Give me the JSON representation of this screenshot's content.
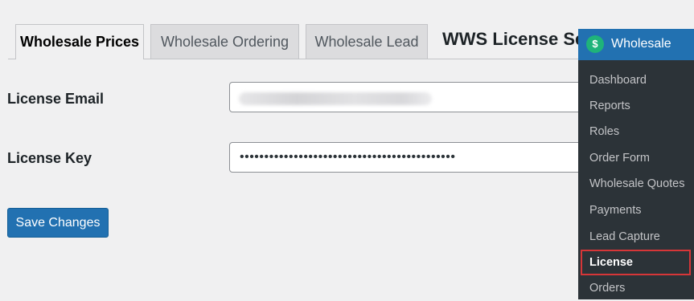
{
  "tabs": [
    {
      "label": "Wholesale Prices",
      "active": true
    },
    {
      "label": "Wholesale Ordering",
      "active": false
    },
    {
      "label": "Wholesale Lead",
      "active": false
    }
  ],
  "page_heading": "WWS License Sett",
  "form": {
    "email_label": "License Email",
    "email_value": "",
    "key_label": "License Key",
    "key_value": "••••••••••••••••••••••••••••••••••••••••••••",
    "save_label": "Save Changes"
  },
  "menu": {
    "title": "Wholesale",
    "logo_icon": "wholesale-logo-icon",
    "items": [
      {
        "label": "Dashboard"
      },
      {
        "label": "Reports"
      },
      {
        "label": "Roles"
      },
      {
        "label": "Order Form"
      },
      {
        "label": "Wholesale Quotes"
      },
      {
        "label": "Payments"
      },
      {
        "label": "Lead Capture"
      },
      {
        "label": "License",
        "current": true
      },
      {
        "label": "Orders"
      }
    ]
  },
  "colors": {
    "accent": "#2271b1",
    "menu_bg": "#2c3338",
    "highlight": "#d63638"
  }
}
